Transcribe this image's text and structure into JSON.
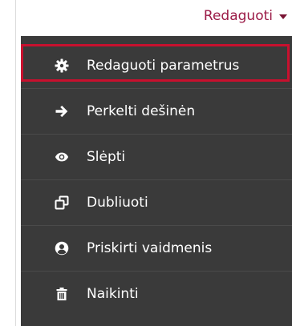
{
  "trigger": {
    "label": "Redaguoti",
    "icon": "caret-down-icon"
  },
  "menu": {
    "items": [
      {
        "label": "Redaguoti parametrus",
        "icon": "cog-icon",
        "highlighted": true
      },
      {
        "label": "Perkelti dešinėn",
        "icon": "arrow-right-icon"
      },
      {
        "label": "Slėpti",
        "icon": "eye-icon"
      },
      {
        "label": "Dubliuoti",
        "icon": "copy-icon"
      },
      {
        "label": "Priskirti vaidmenis",
        "icon": "user-circle-icon"
      },
      {
        "label": "Naikinti",
        "icon": "trash-icon"
      }
    ]
  },
  "colors": {
    "accent": "#9b1b47",
    "menu_background": "#3a3a3a",
    "highlight_border": "#c8102e"
  }
}
